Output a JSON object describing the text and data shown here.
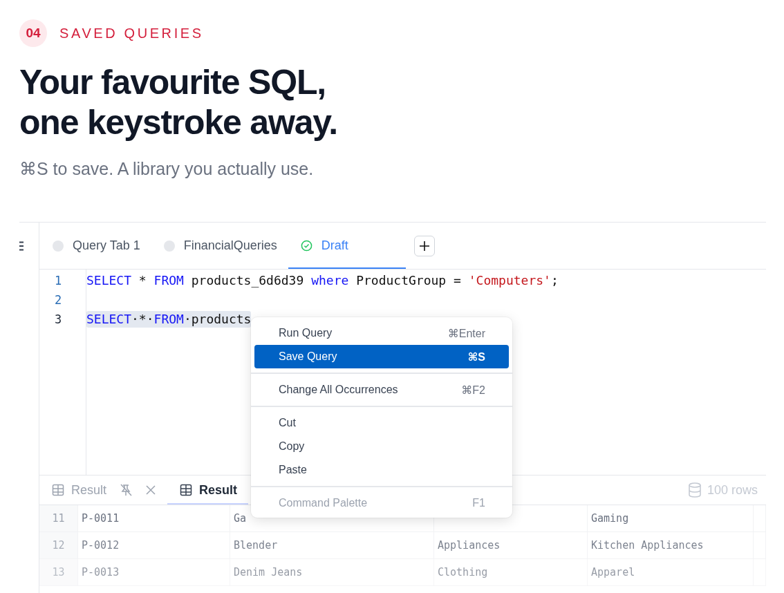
{
  "header": {
    "step": "04",
    "eyebrow": "SAVED QUERIES",
    "title_lines": [
      "Your favourite SQL,",
      "one keystroke away."
    ],
    "subtitle": "⌘S to save. A library you actually use."
  },
  "editor": {
    "tabs": [
      {
        "label": "Query Tab 1",
        "saved": false,
        "selected": false
      },
      {
        "label": "FinancialQueries",
        "saved": false,
        "selected": false
      },
      {
        "label": "Draft",
        "saved": true,
        "selected": true
      }
    ],
    "lines": [
      {
        "number": "1",
        "selected": false,
        "tokens": [
          {
            "kind": "keyword",
            "text": "SELECT"
          },
          {
            "kind": "plain",
            "text": " * "
          },
          {
            "kind": "keyword",
            "text": "FROM"
          },
          {
            "kind": "plain",
            "text": " products_6d6d39 "
          },
          {
            "kind": "keyword",
            "text": "where"
          },
          {
            "kind": "plain",
            "text": " ProductGroup = "
          },
          {
            "kind": "string",
            "text": "'Computers'"
          },
          {
            "kind": "plain",
            "text": ";"
          }
        ]
      },
      {
        "number": "2",
        "selected": false
      },
      {
        "number": "3",
        "selected": true,
        "tokens": [
          {
            "kind": "keyword",
            "text": "SELECT"
          },
          {
            "kind": "plain",
            "text": "·*·"
          },
          {
            "kind": "keyword",
            "text": "FROM"
          },
          {
            "kind": "plain",
            "text": "·products"
          }
        ]
      }
    ]
  },
  "context_menu": [
    {
      "kind": "item",
      "label": "Run Query",
      "shortcut": "⌘Enter",
      "selected": false,
      "disabled": false
    },
    {
      "kind": "item",
      "label": "Save Query",
      "shortcut": "⌘S",
      "selected": true,
      "disabled": false
    },
    {
      "kind": "separator"
    },
    {
      "kind": "item",
      "label": "Change All Occurrences",
      "shortcut": "⌘F2",
      "selected": false,
      "disabled": false
    },
    {
      "kind": "separator"
    },
    {
      "kind": "item",
      "label": "Cut",
      "selected": false,
      "disabled": false
    },
    {
      "kind": "item",
      "label": "Copy",
      "selected": false,
      "disabled": false
    },
    {
      "kind": "item",
      "label": "Paste",
      "selected": false,
      "disabled": false
    },
    {
      "kind": "separator"
    },
    {
      "kind": "item",
      "label": "Command Palette",
      "shortcut": "F1",
      "selected": false,
      "disabled": true
    }
  ],
  "results": {
    "tabs": [
      {
        "label": "Result",
        "selected": false,
        "closable": true
      },
      {
        "label": "Result",
        "selected": true,
        "closable": false
      }
    ],
    "row_count": "100 rows",
    "rows": [
      {
        "cells": [
          "11",
          "P-0011",
          "Ga",
          null,
          "Gaming"
        ]
      },
      {
        "cells": [
          "12",
          "P-0012",
          "Blender",
          "Appliances",
          "Kitchen Appliances"
        ]
      },
      {
        "cells": [
          "13",
          "P-0013",
          "Denim Jeans",
          "Clothing",
          "Apparel"
        ]
      }
    ]
  }
}
